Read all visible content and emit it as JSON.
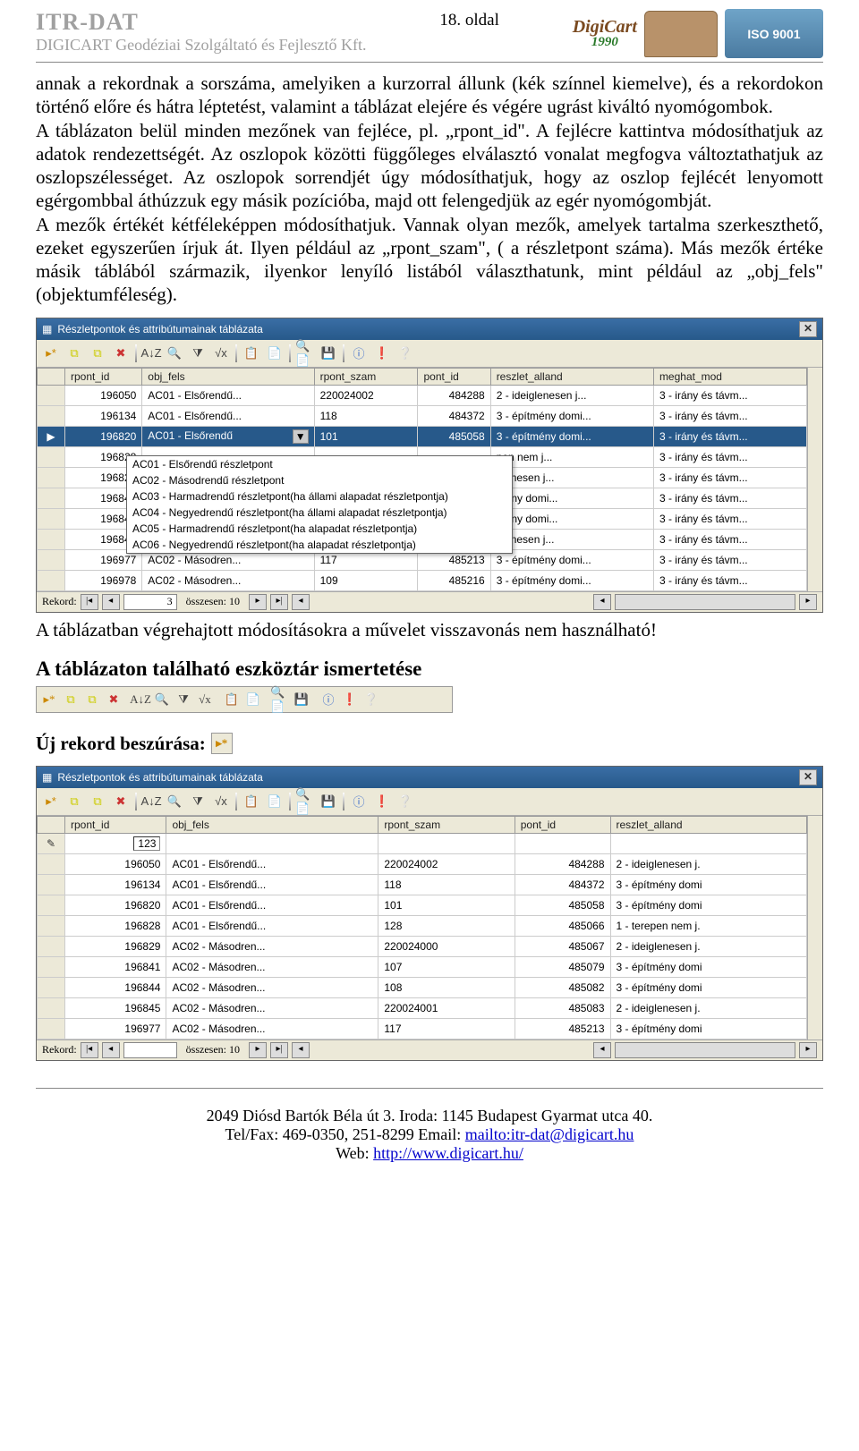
{
  "header": {
    "title": "ITR-DAT",
    "subtitle": "DIGICART Geodéziai Szolgáltató és Fejlesztő Kft.",
    "page": "18. oldal",
    "logo_name": "DigiCart",
    "logo_year": "1990",
    "iso": "ISO 9001"
  },
  "body": {
    "p1": "annak a rekordnak a sorszáma, amelyiken a kurzorral állunk (kék színnel kiemelve), és a rekordokon történő előre és hátra léptetést, valamint a táblázat elejére és végére ugrást kiváltó nyomógombok.",
    "p2": "A táblázaton belül minden mezőnek van fejléce, pl. „rpont_id\". A fejlécre kattintva módosíthatjuk az adatok rendezettségét. Az oszlopok közötti függőleges elválasztó vonalat megfogva változtathatjuk az oszlopszélességet. Az oszlopok sorrendjét úgy módosíthatjuk, hogy az oszlop fejlécét lenyomott egérgombbal áthúzzuk egy másik pozícióba, majd ott felengedjük az egér nyomógombját.",
    "p3": "A mezők értékét kétféleképpen módosíthatjuk. Vannak olyan mezők, amelyek tartalma szerkeszthető, ezeket egyszerűen írjuk át. Ilyen például az „rpont_szam\", ( a részletpont száma). Más mezők értéke másik táblából származik, ilyenkor lenyíló listából választhatunk, mint például az „obj_fels\" (objektumféleség).",
    "note": "A táblázatban végrehajtott módosításokra a művelet visszavonás nem használható!",
    "h1": "A táblázaton található eszköztár ismertetése",
    "h2": "Új rekord beszúrása:"
  },
  "table1": {
    "title": "Részletpontok és attribútumainak táblázata",
    "cols": [
      "rpont_id",
      "obj_fels",
      "rpont_szam",
      "pont_id",
      "reszlet_alland",
      "meghat_mod"
    ],
    "rows": [
      [
        "196050",
        "AC01 - Elsőrendű...",
        "220024002",
        "484288",
        "2 - ideiglenesen j...",
        "3 - irány és távm..."
      ],
      [
        "196134",
        "AC01 - Elsőrendű...",
        "118",
        "484372",
        "3 - építmény domi...",
        "3 - irány és távm..."
      ],
      [
        "196820",
        "AC01 - Elsőrendű",
        "101",
        "485058",
        "3 - építmény domi...",
        "3 - irány és távm..."
      ],
      [
        "196828",
        "",
        "",
        "",
        "pen nem j...",
        "3 - irány és távm..."
      ],
      [
        "196829",
        "",
        "",
        "",
        "glenesen j...",
        "3 - irány és távm..."
      ],
      [
        "196841",
        "",
        "",
        "",
        "mény domi...",
        "3 - irány és távm..."
      ],
      [
        "196844",
        "",
        "",
        "",
        "mény domi...",
        "3 - irány és távm..."
      ],
      [
        "196845",
        "",
        "",
        "",
        "glenesen j...",
        "3 - irány és távm..."
      ],
      [
        "196977",
        "AC02 - Másodren...",
        "117",
        "485213",
        "3 - építmény domi...",
        "3 - irány és távm..."
      ],
      [
        "196978",
        "AC02 - Másodren...",
        "109",
        "485216",
        "3 - építmény domi...",
        "3 - irány és távm..."
      ]
    ],
    "sel_index": 2,
    "dropdown": [
      "AC01 - Elsőrendű részletpont",
      "AC02 - Másodrendű részletpont",
      "AC03 - Harmadrendű részletpont(ha állami alapadat részletpontja)",
      "AC04 - Negyedrendű részletpont(ha állami alapadat részletpontja)",
      "AC05 - Harmadrendű részletpont(ha alapadat részletpontja)",
      "AC06 - Negyedrendű részletpont(ha alapadat részletpontja)"
    ],
    "nav": {
      "label": "Rekord:",
      "current": "3",
      "total_label": "összesen: 10"
    }
  },
  "table2": {
    "title": "Részletpontok és attribútumainak táblázata",
    "cols": [
      "rpont_id",
      "obj_fels",
      "rpont_szam",
      "pont_id",
      "reszlet_alland"
    ],
    "new_value": "123",
    "rows": [
      [
        "196050",
        "AC01 - Elsőrendű...",
        "220024002",
        "484288",
        "2 - ideiglenesen j."
      ],
      [
        "196134",
        "AC01 - Elsőrendű...",
        "118",
        "484372",
        "3 - építmény domi"
      ],
      [
        "196820",
        "AC01 - Elsőrendű...",
        "101",
        "485058",
        "3 - építmény domi"
      ],
      [
        "196828",
        "AC01 - Elsőrendű...",
        "128",
        "485066",
        "1 - terepen nem j."
      ],
      [
        "196829",
        "AC02 - Másodren...",
        "220024000",
        "485067",
        "2 - ideiglenesen j."
      ],
      [
        "196841",
        "AC02 - Másodren...",
        "107",
        "485079",
        "3 - építmény domi"
      ],
      [
        "196844",
        "AC02 - Másodren...",
        "108",
        "485082",
        "3 - építmény domi"
      ],
      [
        "196845",
        "AC02 - Másodren...",
        "220024001",
        "485083",
        "2 - ideiglenesen j."
      ],
      [
        "196977",
        "AC02 - Másodren...",
        "117",
        "485213",
        "3 - építmény domi"
      ]
    ],
    "nav": {
      "label": "Rekord:",
      "current": "",
      "total_label": "összesen: 10"
    }
  },
  "footer": {
    "addr": "2049 Diósd Bartók Béla út 3. Iroda: 1145 Budapest Gyarmat utca 40.",
    "tel": "Tel/Fax: 469-0350, 251-8299 Email: ",
    "email": "mailto:itr-dat@digicart.hu",
    "web_label": "Web: ",
    "web": "http://www.digicart.hu/"
  },
  "icons": {
    "new": "▸*",
    "del": "✖",
    "a1": "⧉",
    "a2": "⧉",
    "sort": "A↓Z",
    "find": "🔍",
    "filt": "⧩",
    "vx": "√x",
    "copy": "📋",
    "page": "📄",
    "ref": "🔍📄",
    "save": "💾",
    "info": "ⓘ",
    "warn": "❗",
    "q": "❔"
  }
}
